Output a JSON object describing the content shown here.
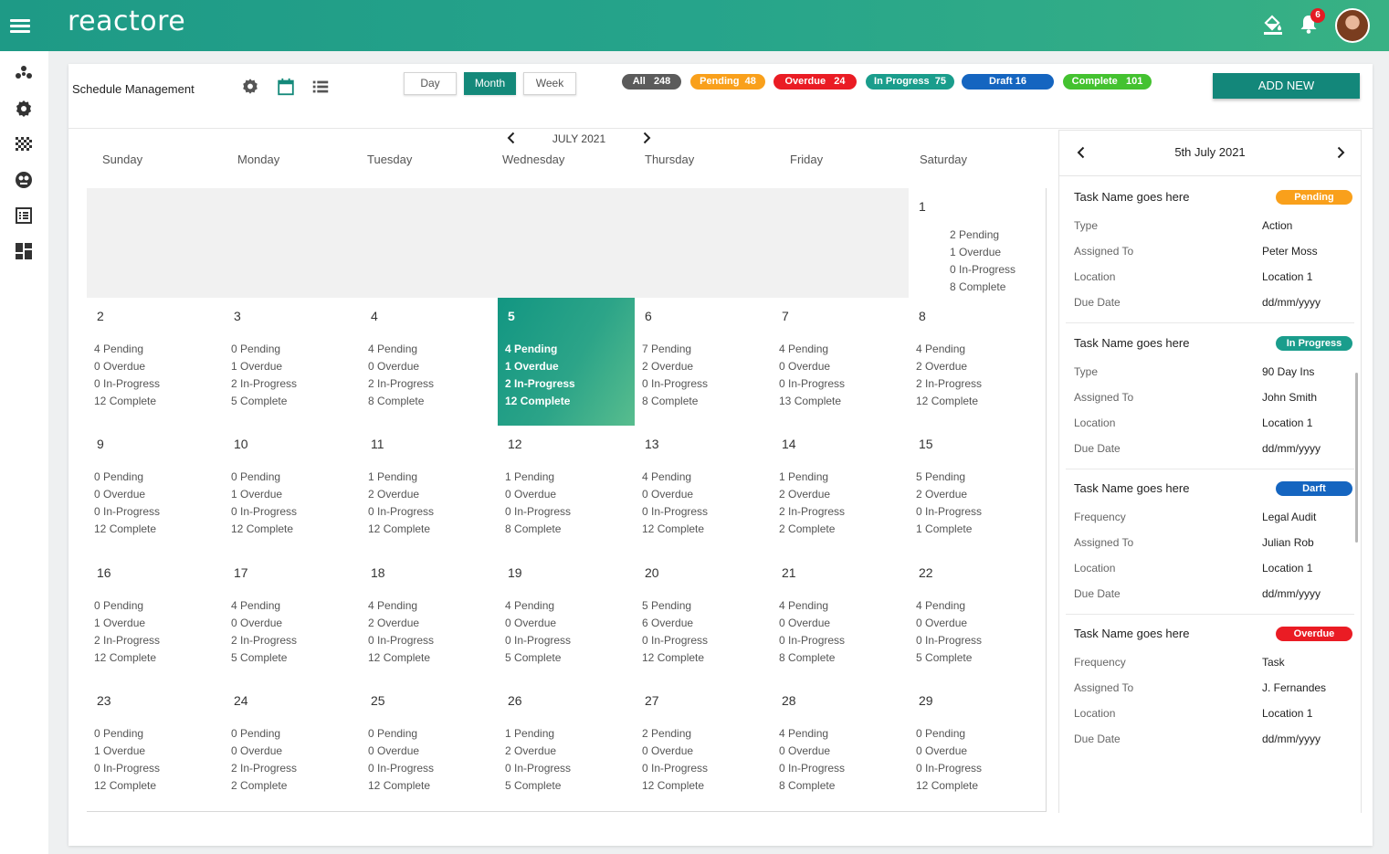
{
  "app": {
    "logo": "reactore",
    "notification_count": "6"
  },
  "colors": {
    "brand": "#1e9a86",
    "active": "#14897a",
    "pending": "#f9a01b",
    "overdue": "#ea1c24",
    "in_progress": "#1a9d8c",
    "draft": "#1565c0",
    "complete": "#44c230",
    "all": "#5b5b5b"
  },
  "sidebar": {
    "items": [
      "network-icon",
      "gear-icon",
      "checker-grid-icon",
      "globe-icon",
      "list-icon",
      "dashboard-icon"
    ]
  },
  "header": {
    "title": "Schedule Management",
    "views": [
      {
        "label": "Day",
        "active": false
      },
      {
        "label": "Month",
        "active": true
      },
      {
        "label": "Week",
        "active": false
      }
    ],
    "filters": [
      {
        "label": "All",
        "count": "248"
      },
      {
        "label": "Pending",
        "count": "48"
      },
      {
        "label": "Overdue",
        "count": "24"
      },
      {
        "label": "In Progress",
        "count": "75"
      },
      {
        "label": "Draft",
        "count": "16"
      },
      {
        "label": "Complete",
        "count": "101"
      }
    ],
    "add_button": "ADD NEW"
  },
  "calendar": {
    "month": "JULY 2021",
    "weekdays": [
      "Sunday",
      "Monday",
      "Tuesday",
      "Wednesday",
      "Thursday",
      "Friday",
      "Saturday"
    ],
    "stat_labels": [
      "Pending",
      "Overdue",
      "In-Progress",
      "Complete"
    ],
    "selected_day": "5",
    "weeks": [
      [
        null,
        null,
        null,
        null,
        null,
        null,
        {
          "day": "1",
          "stats": [
            2,
            1,
            0,
            8
          ]
        }
      ],
      [
        {
          "day": "2",
          "stats": [
            4,
            0,
            0,
            12
          ]
        },
        {
          "day": "3",
          "stats": [
            0,
            1,
            2,
            5
          ]
        },
        {
          "day": "4",
          "stats": [
            4,
            0,
            2,
            8
          ]
        },
        {
          "day": "5",
          "stats": [
            4,
            1,
            2,
            12
          ]
        },
        {
          "day": "6",
          "stats": [
            7,
            2,
            0,
            8
          ]
        },
        {
          "day": "7",
          "stats": [
            4,
            0,
            0,
            13
          ]
        },
        {
          "day": "8",
          "stats": [
            4,
            2,
            2,
            12
          ]
        }
      ],
      [
        {
          "day": "9",
          "stats": [
            0,
            0,
            0,
            12
          ]
        },
        {
          "day": "10",
          "stats": [
            0,
            1,
            0,
            12
          ]
        },
        {
          "day": "11",
          "stats": [
            1,
            2,
            0,
            12
          ]
        },
        {
          "day": "12",
          "stats": [
            1,
            0,
            0,
            8
          ]
        },
        {
          "day": "13",
          "stats": [
            4,
            0,
            0,
            12
          ]
        },
        {
          "day": "14",
          "stats": [
            1,
            2,
            2,
            2
          ]
        },
        {
          "day": "15",
          "stats": [
            5,
            2,
            0,
            1
          ]
        }
      ],
      [
        {
          "day": "16",
          "stats": [
            0,
            1,
            2,
            12
          ]
        },
        {
          "day": "17",
          "stats": [
            4,
            0,
            2,
            5
          ]
        },
        {
          "day": "18",
          "stats": [
            4,
            2,
            0,
            12
          ]
        },
        {
          "day": "19",
          "stats": [
            4,
            0,
            0,
            5
          ]
        },
        {
          "day": "20",
          "stats": [
            5,
            6,
            0,
            12
          ]
        },
        {
          "day": "21",
          "stats": [
            4,
            0,
            0,
            8
          ]
        },
        {
          "day": "22",
          "stats": [
            4,
            0,
            0,
            5
          ]
        }
      ],
      [
        {
          "day": "23",
          "stats": [
            0,
            1,
            0,
            12
          ]
        },
        {
          "day": "24",
          "stats": [
            0,
            0,
            2,
            2
          ]
        },
        {
          "day": "25",
          "stats": [
            0,
            0,
            0,
            12
          ]
        },
        {
          "day": "26",
          "stats": [
            1,
            2,
            0,
            5
          ]
        },
        {
          "day": "27",
          "stats": [
            2,
            0,
            0,
            12
          ]
        },
        {
          "day": "28",
          "stats": [
            4,
            0,
            0,
            8
          ]
        },
        {
          "day": "29",
          "stats": [
            0,
            0,
            0,
            12
          ]
        }
      ]
    ]
  },
  "panel": {
    "date": "5th July 2021",
    "tasks": [
      {
        "name": "Task Name goes here",
        "status": "Pending",
        "status_color": "#f9a01b",
        "rows": [
          [
            "Type",
            "Action"
          ],
          [
            "Assigned To",
            "Peter Moss"
          ],
          [
            "Location",
            "Location 1"
          ],
          [
            "Due Date",
            "dd/mm/yyyy"
          ]
        ]
      },
      {
        "name": "Task Name goes here",
        "status": "In Progress",
        "status_color": "#1a9d8c",
        "rows": [
          [
            "Type",
            "90 Day Ins"
          ],
          [
            "Assigned To",
            "John Smith"
          ],
          [
            "Location",
            "Location 1"
          ],
          [
            "Due Date",
            "dd/mm/yyyy"
          ]
        ]
      },
      {
        "name": "Task Name goes here",
        "status": "Darft",
        "status_color": "#1565c0",
        "rows": [
          [
            "Frequency",
            "Legal Audit"
          ],
          [
            "Assigned To",
            "Julian Rob"
          ],
          [
            "Location",
            "Location 1"
          ],
          [
            "Due Date",
            "dd/mm/yyyy"
          ]
        ]
      },
      {
        "name": "Task Name goes here",
        "status": "Overdue",
        "status_color": "#ea1c24",
        "rows": [
          [
            "Frequency",
            "Task"
          ],
          [
            "Assigned To",
            "J. Fernandes"
          ],
          [
            "Location",
            "Location 1"
          ],
          [
            "Due Date",
            "dd/mm/yyyy"
          ]
        ]
      }
    ]
  }
}
